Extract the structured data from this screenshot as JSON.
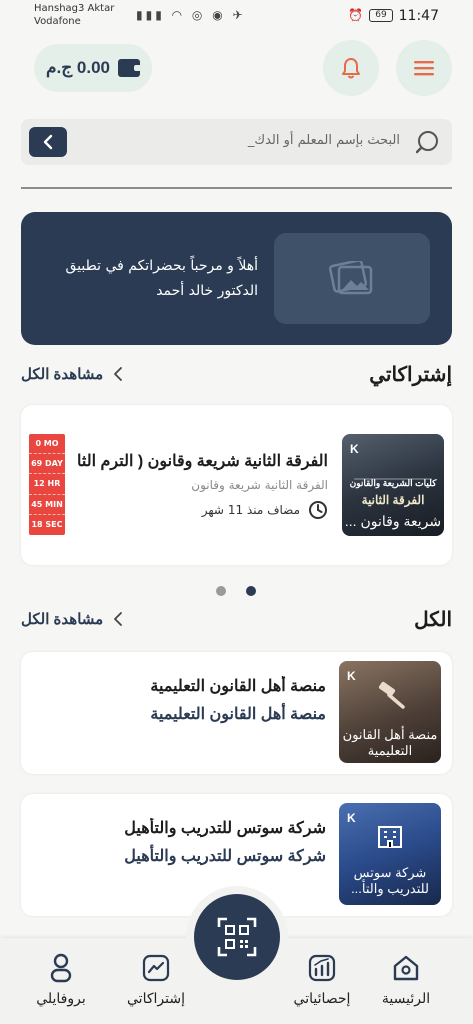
{
  "status_bar": {
    "carrier1": "Hanshag3 Aktar",
    "carrier2": "Vodafone",
    "battery": "69",
    "time": "11:47"
  },
  "header": {
    "balance": "0.00 ج.م",
    "icons": [
      "wallet-icon",
      "bell-icon",
      "menu-icon"
    ]
  },
  "search": {
    "placeholder": "البحث بإسم المعلم أو الدك_"
  },
  "banner": {
    "text": "أهلاً و مرحباً بحضراتكم في تطبيق الدكتور خالد أحمد"
  },
  "subscriptions": {
    "title": "إشتراكاتي",
    "see_all": "مشاهدة الكل",
    "card": {
      "title": "الفرقة الثانية شريعة وقانون ( الترم الثا...",
      "subtitle": "الفرقة الثانية شريعة وقانون",
      "added": "مضاف منذ 11 شهر",
      "thumb_top": "كليات الشريعة والقانون",
      "thumb_mid": "الفرقة الثانية",
      "thumb_caption": "شريعة وقانون ...",
      "countdown": [
        "0 MO",
        "69 DAY",
        "12 HR",
        "45 MIN",
        "18 SEC"
      ]
    },
    "pager": {
      "count": 2,
      "active": 1
    }
  },
  "all": {
    "title": "الكل",
    "see_all": "مشاهدة الكل",
    "items": [
      {
        "title": "منصة أهل القانون التعليمية",
        "subtitle": "منصة أهل القانون التعليمية",
        "thumb_caption": "منصة أهل القانون التعليمية"
      },
      {
        "title": "شركة سوتس للتدريب والتأهيل",
        "subtitle": "شركة سوتس للتدريب والتأهيل",
        "thumb_caption": "شركة سوتس للتدريب والتأ..."
      }
    ]
  },
  "bottom_nav": {
    "items": [
      {
        "label": "بروفايلي",
        "icon": "person-icon"
      },
      {
        "label": "إشتراكاتي",
        "icon": "chart-line-icon"
      },
      {
        "label": "إحصائياتي",
        "icon": "stats-icon"
      },
      {
        "label": "الرئيسية",
        "icon": "home-icon"
      }
    ],
    "fab_icon": "qr-scan-icon"
  },
  "colors": {
    "primary": "#2b3b54",
    "mint": "#e4efe9",
    "accent_red": "#e8463e",
    "background": "#f6f6f4"
  }
}
